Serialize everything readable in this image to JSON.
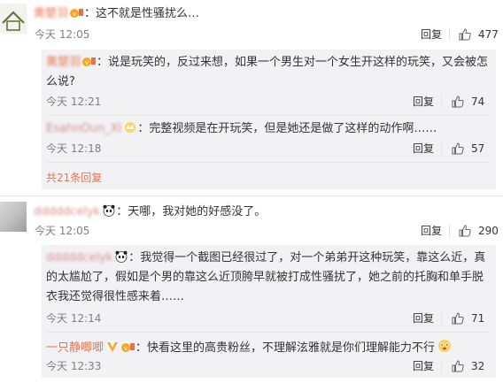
{
  "comments": [
    {
      "username": "黄楚羽",
      "text": "：这不就是性骚扰么…",
      "time": "今天 12:05",
      "reply_label": "回复",
      "likes": "477",
      "sub_replies": [
        {
          "username": "黄楚羽",
          "text": "：说是玩笑的，反过来想，如果一个男生对一个女生开这样的玩笑，又会被怎么说?",
          "time": "今天 12:21",
          "reply_label": "回复",
          "likes": "74"
        },
        {
          "username": "EsahnOun_XI",
          "text": "：完整视频是在开玩笑，但是她还是做了这样的动作啊……",
          "time": "今天 12:18",
          "reply_label": "回复",
          "likes": "57"
        }
      ],
      "more_replies": "共21条回复"
    },
    {
      "username": "dddddcelyk",
      "text": "：天哪，我对她的好感没了。",
      "time": "今天 12:05",
      "reply_label": "回复",
      "likes": "290",
      "sub_replies": [
        {
          "username": "dddddcelyk",
          "text": "：我觉得一个截图已经很过了，对一个弟弟开这种玩笑，靠这么近，真的太尴尬了，假如是个男的靠这么近顶胯早就被打成性骚扰了，她之前的托胸和单手脱衣我还觉得很性感来着……",
          "time": "今天 12:14",
          "reply_label": "回复",
          "likes": "71"
        },
        {
          "username": "一只静唧唧",
          "text": "：快看这里的高贵粉丝，不理解泫雅就是你们理解能力不行",
          "time": "今天 12:33",
          "reply_label": "回复",
          "likes": "32"
        }
      ]
    }
  ],
  "colors": {
    "link": "#eb7350",
    "time": "#808080",
    "sub_bg": "#f2f2f5"
  }
}
